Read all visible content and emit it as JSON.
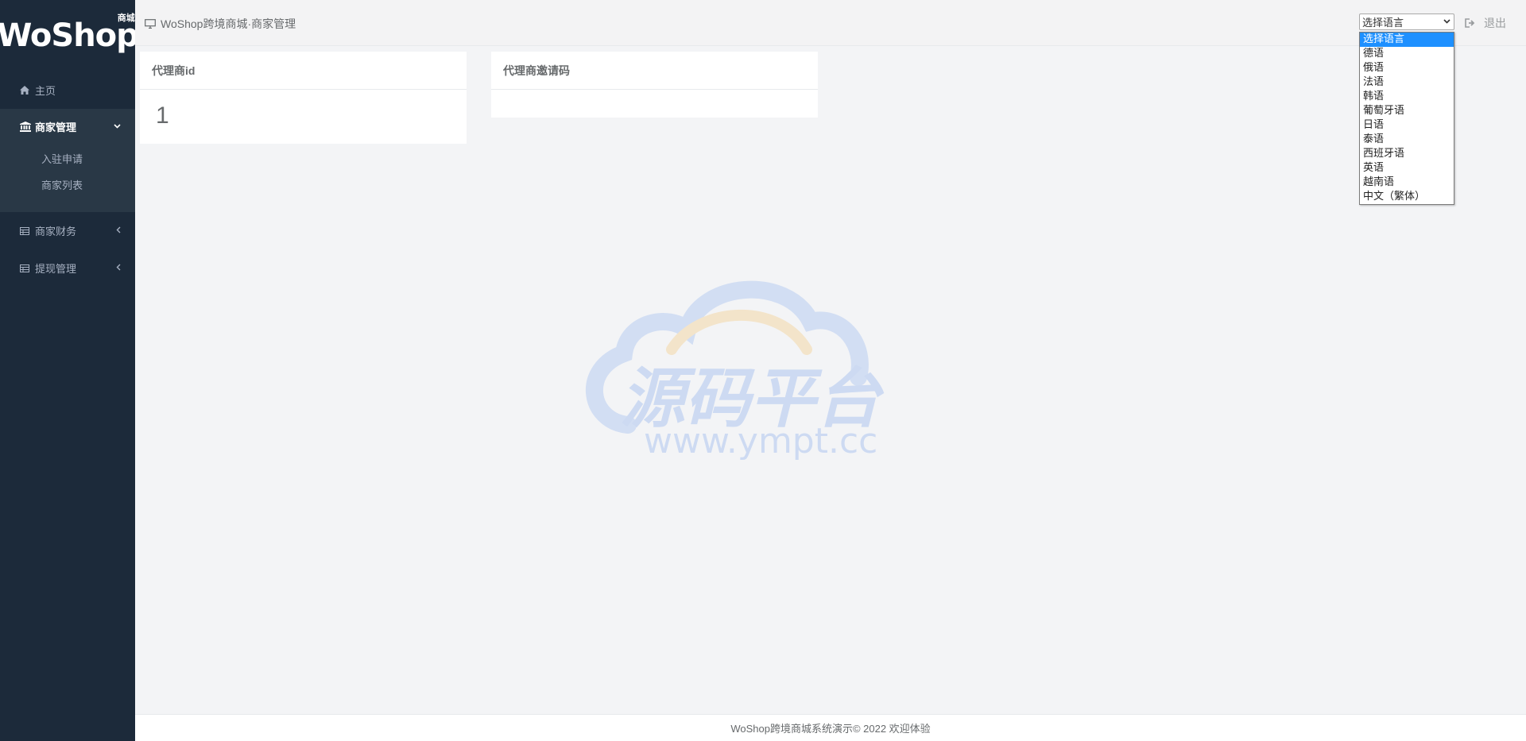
{
  "brand": {
    "logo_text": "WoShop",
    "logo_sub": "商城"
  },
  "sidebar": {
    "items": [
      {
        "label": "主页",
        "icon": "home-icon"
      },
      {
        "label": "商家管理",
        "icon": "bank-icon",
        "expanded": true,
        "children": [
          {
            "label": "入驻申请"
          },
          {
            "label": "商家列表"
          }
        ]
      },
      {
        "label": "商家财务",
        "icon": "table-icon"
      },
      {
        "label": "提现管理",
        "icon": "table-icon"
      }
    ]
  },
  "header": {
    "breadcrumb": "WoShop跨境商城·商家管理",
    "language_select": {
      "value": "选择语言",
      "options": [
        "选择语言",
        "德语",
        "俄语",
        "法语",
        "韩语",
        "葡萄牙语",
        "日语",
        "泰语",
        "西班牙语",
        "英语",
        "越南语",
        "中文（繁体）"
      ]
    },
    "logout_label": "退出"
  },
  "cards": [
    {
      "title": "代理商id",
      "value": "1"
    },
    {
      "title": "代理商邀请码",
      "value": ""
    }
  ],
  "watermark": {
    "text_cn": "源码平台",
    "text_url": "www.ympt.cc"
  },
  "footer": {
    "text": "WoShop跨境商城系统演示© 2022 欢迎体验"
  },
  "colors": {
    "sidebar_bg": "#1c2a3a",
    "sidebar_active": "#293846",
    "select_highlight": "#1e90ff"
  }
}
